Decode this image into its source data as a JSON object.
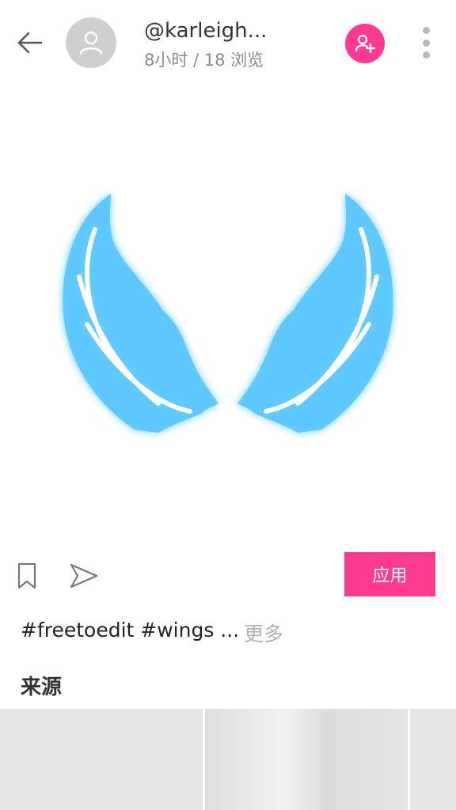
{
  "header": {
    "username": "@karleigh...",
    "meta": "8小时 / 18 浏览"
  },
  "icons": {
    "back": "back-arrow-icon",
    "avatar": "user-avatar-icon",
    "follow": "add-user-icon",
    "more": "more-vertical-icon",
    "bookmark": "bookmark-icon",
    "share": "send-icon"
  },
  "actions": {
    "apply_label": "应用"
  },
  "post": {
    "tags": "#freetoedit #wings ...",
    "more_label": "更多"
  },
  "source": {
    "heading": "来源"
  },
  "colors": {
    "accent": "#ff3a90",
    "wing_glow": "#5cc8ff"
  }
}
